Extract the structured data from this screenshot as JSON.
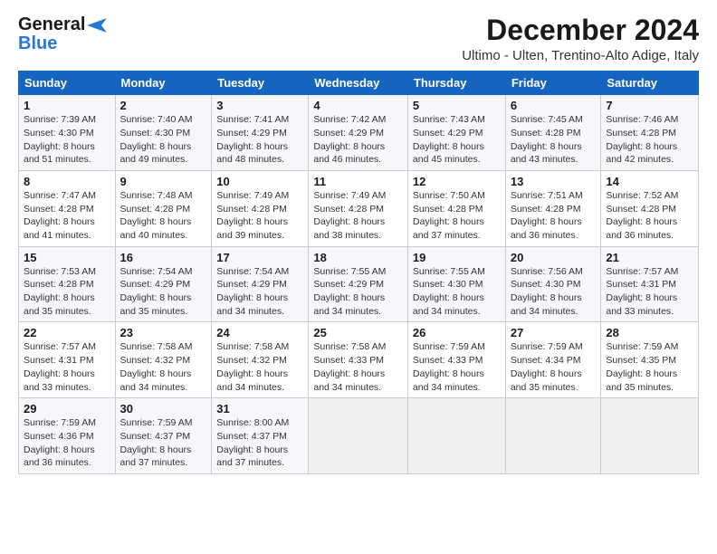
{
  "header": {
    "logo_line1": "General",
    "logo_line2": "Blue",
    "title": "December 2024",
    "subtitle": "Ultimo - Ulten, Trentino-Alto Adige, Italy"
  },
  "calendar": {
    "days_of_week": [
      "Sunday",
      "Monday",
      "Tuesday",
      "Wednesday",
      "Thursday",
      "Friday",
      "Saturday"
    ],
    "weeks": [
      [
        {
          "day": 1,
          "info": "Sunrise: 7:39 AM\nSunset: 4:30 PM\nDaylight: 8 hours\nand 51 minutes."
        },
        {
          "day": 2,
          "info": "Sunrise: 7:40 AM\nSunset: 4:30 PM\nDaylight: 8 hours\nand 49 minutes."
        },
        {
          "day": 3,
          "info": "Sunrise: 7:41 AM\nSunset: 4:29 PM\nDaylight: 8 hours\nand 48 minutes."
        },
        {
          "day": 4,
          "info": "Sunrise: 7:42 AM\nSunset: 4:29 PM\nDaylight: 8 hours\nand 46 minutes."
        },
        {
          "day": 5,
          "info": "Sunrise: 7:43 AM\nSunset: 4:29 PM\nDaylight: 8 hours\nand 45 minutes."
        },
        {
          "day": 6,
          "info": "Sunrise: 7:45 AM\nSunset: 4:28 PM\nDaylight: 8 hours\nand 43 minutes."
        },
        {
          "day": 7,
          "info": "Sunrise: 7:46 AM\nSunset: 4:28 PM\nDaylight: 8 hours\nand 42 minutes."
        }
      ],
      [
        {
          "day": 8,
          "info": "Sunrise: 7:47 AM\nSunset: 4:28 PM\nDaylight: 8 hours\nand 41 minutes."
        },
        {
          "day": 9,
          "info": "Sunrise: 7:48 AM\nSunset: 4:28 PM\nDaylight: 8 hours\nand 40 minutes."
        },
        {
          "day": 10,
          "info": "Sunrise: 7:49 AM\nSunset: 4:28 PM\nDaylight: 8 hours\nand 39 minutes."
        },
        {
          "day": 11,
          "info": "Sunrise: 7:49 AM\nSunset: 4:28 PM\nDaylight: 8 hours\nand 38 minutes."
        },
        {
          "day": 12,
          "info": "Sunrise: 7:50 AM\nSunset: 4:28 PM\nDaylight: 8 hours\nand 37 minutes."
        },
        {
          "day": 13,
          "info": "Sunrise: 7:51 AM\nSunset: 4:28 PM\nDaylight: 8 hours\nand 36 minutes."
        },
        {
          "day": 14,
          "info": "Sunrise: 7:52 AM\nSunset: 4:28 PM\nDaylight: 8 hours\nand 36 minutes."
        }
      ],
      [
        {
          "day": 15,
          "info": "Sunrise: 7:53 AM\nSunset: 4:28 PM\nDaylight: 8 hours\nand 35 minutes."
        },
        {
          "day": 16,
          "info": "Sunrise: 7:54 AM\nSunset: 4:29 PM\nDaylight: 8 hours\nand 35 minutes."
        },
        {
          "day": 17,
          "info": "Sunrise: 7:54 AM\nSunset: 4:29 PM\nDaylight: 8 hours\nand 34 minutes."
        },
        {
          "day": 18,
          "info": "Sunrise: 7:55 AM\nSunset: 4:29 PM\nDaylight: 8 hours\nand 34 minutes."
        },
        {
          "day": 19,
          "info": "Sunrise: 7:55 AM\nSunset: 4:30 PM\nDaylight: 8 hours\nand 34 minutes."
        },
        {
          "day": 20,
          "info": "Sunrise: 7:56 AM\nSunset: 4:30 PM\nDaylight: 8 hours\nand 34 minutes."
        },
        {
          "day": 21,
          "info": "Sunrise: 7:57 AM\nSunset: 4:31 PM\nDaylight: 8 hours\nand 33 minutes."
        }
      ],
      [
        {
          "day": 22,
          "info": "Sunrise: 7:57 AM\nSunset: 4:31 PM\nDaylight: 8 hours\nand 33 minutes."
        },
        {
          "day": 23,
          "info": "Sunrise: 7:58 AM\nSunset: 4:32 PM\nDaylight: 8 hours\nand 34 minutes."
        },
        {
          "day": 24,
          "info": "Sunrise: 7:58 AM\nSunset: 4:32 PM\nDaylight: 8 hours\nand 34 minutes."
        },
        {
          "day": 25,
          "info": "Sunrise: 7:58 AM\nSunset: 4:33 PM\nDaylight: 8 hours\nand 34 minutes."
        },
        {
          "day": 26,
          "info": "Sunrise: 7:59 AM\nSunset: 4:33 PM\nDaylight: 8 hours\nand 34 minutes."
        },
        {
          "day": 27,
          "info": "Sunrise: 7:59 AM\nSunset: 4:34 PM\nDaylight: 8 hours\nand 35 minutes."
        },
        {
          "day": 28,
          "info": "Sunrise: 7:59 AM\nSunset: 4:35 PM\nDaylight: 8 hours\nand 35 minutes."
        }
      ],
      [
        {
          "day": 29,
          "info": "Sunrise: 7:59 AM\nSunset: 4:36 PM\nDaylight: 8 hours\nand 36 minutes."
        },
        {
          "day": 30,
          "info": "Sunrise: 7:59 AM\nSunset: 4:37 PM\nDaylight: 8 hours\nand 37 minutes."
        },
        {
          "day": 31,
          "info": "Sunrise: 8:00 AM\nSunset: 4:37 PM\nDaylight: 8 hours\nand 37 minutes."
        },
        {
          "day": null,
          "info": ""
        },
        {
          "day": null,
          "info": ""
        },
        {
          "day": null,
          "info": ""
        },
        {
          "day": null,
          "info": ""
        }
      ]
    ]
  }
}
